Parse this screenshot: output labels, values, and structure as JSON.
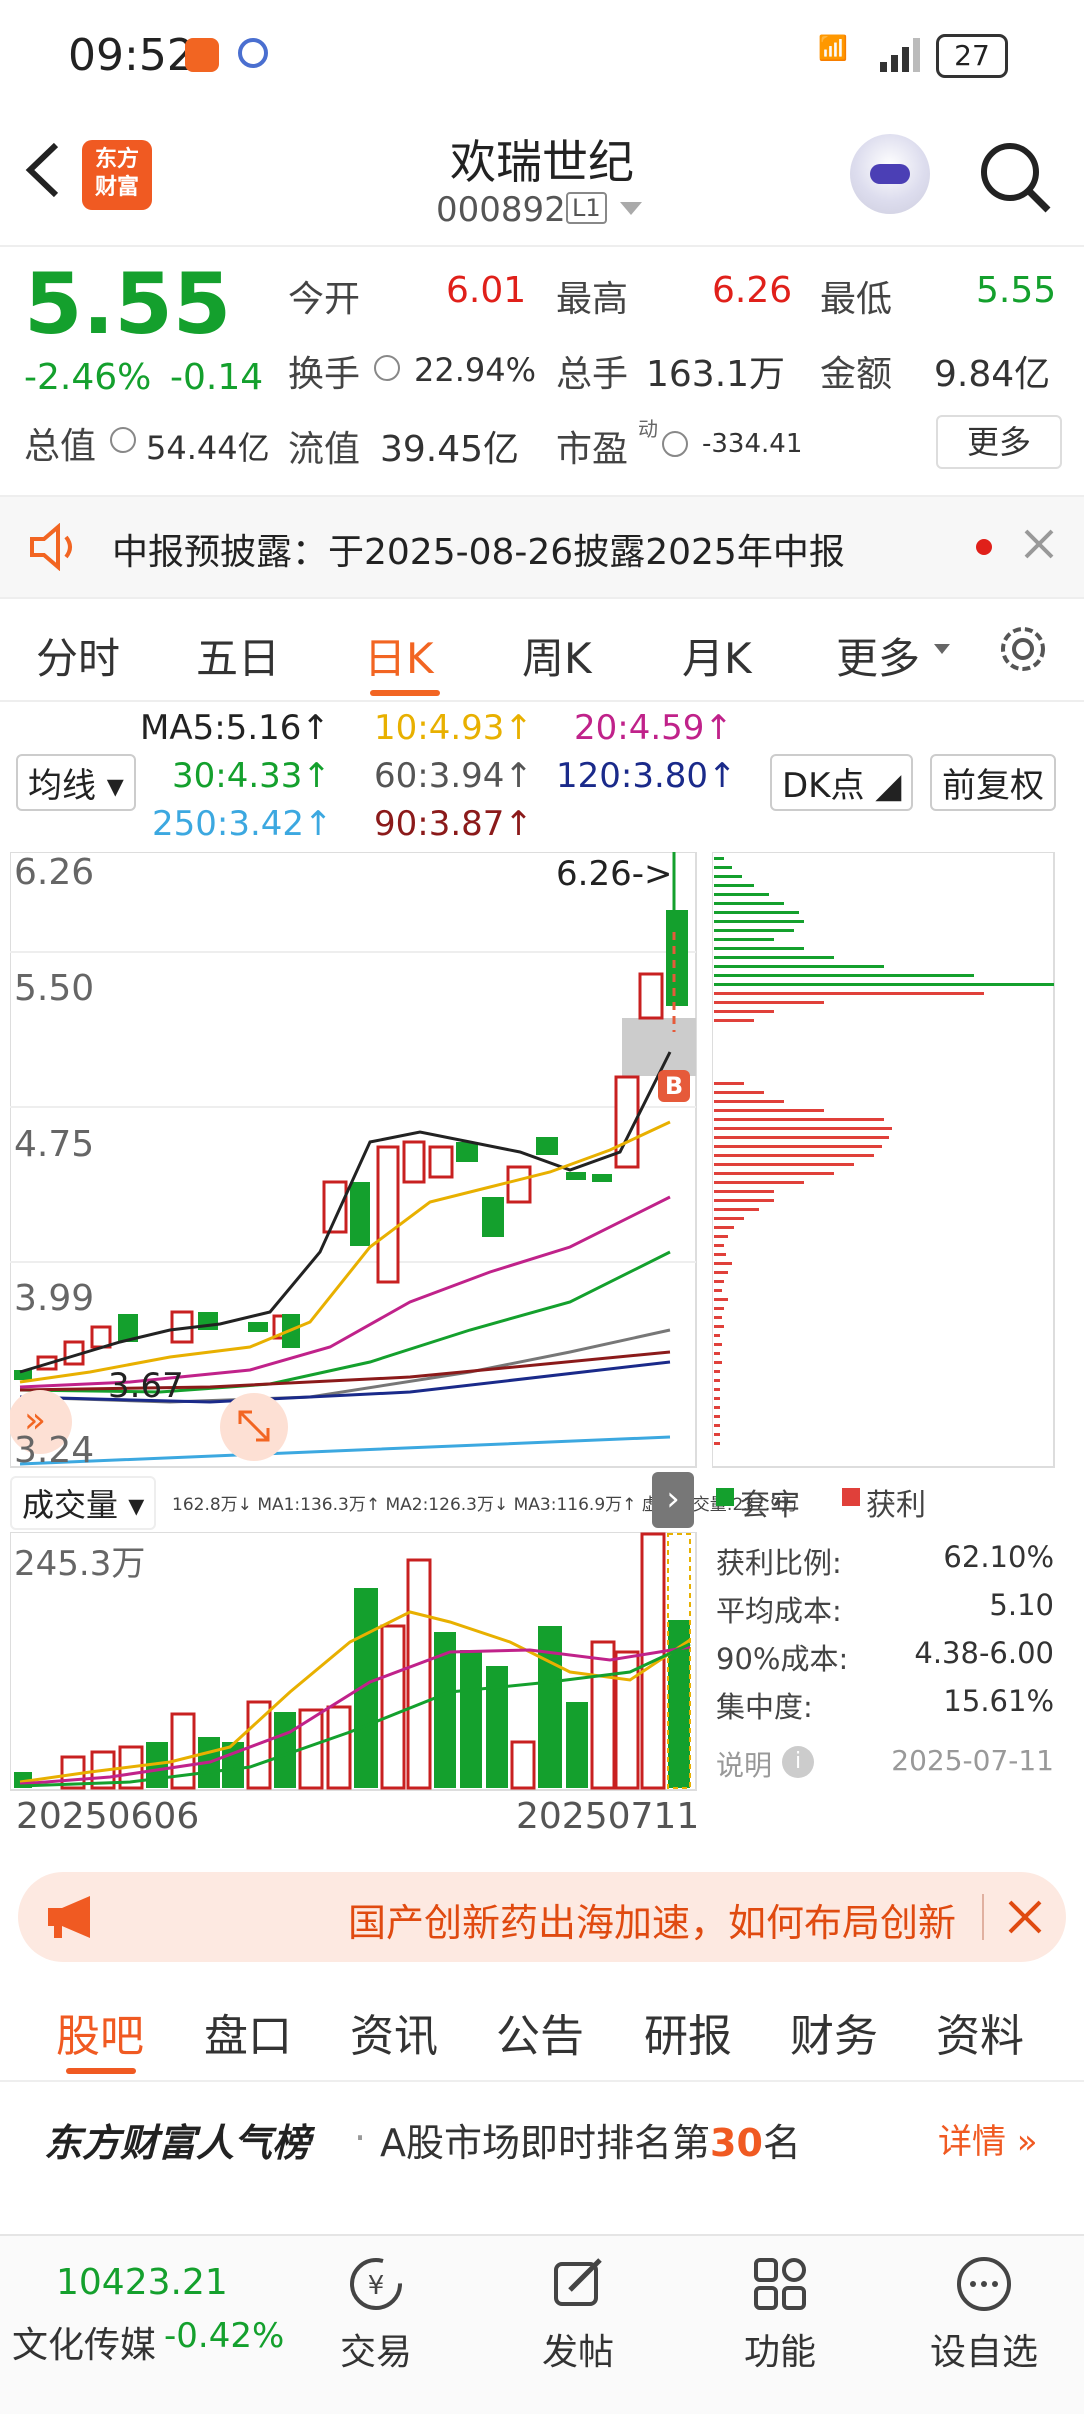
{
  "status_bar": {
    "time": "09:52",
    "battery": "27",
    "network": "5G"
  },
  "header": {
    "back_icon": "chevron-left-icon",
    "logo_text": "东方\n财富",
    "stock_name": "欢瑞世纪",
    "stock_code": "000892",
    "level_badge": "L1",
    "avatar_icon": "robot-avatar-icon",
    "search_icon": "search-icon"
  },
  "quote": {
    "price": "5.55",
    "change_pct": "-2.46%",
    "change_amt": "-0.14",
    "open_label": "今开",
    "open": "6.01",
    "high_label": "最高",
    "high": "6.26",
    "low_label": "最低",
    "low": "5.55",
    "turnover_label": "换手",
    "turnover": "22.94%",
    "volume_label": "总手",
    "volume": "163.1万",
    "amount_label": "金额",
    "amount": "9.84亿",
    "mktcap_label": "总值",
    "mktcap": "54.44亿",
    "float_label": "流值",
    "float": "39.45亿",
    "pe_label": "市盈",
    "pe_sup": "动",
    "pe": "-334.41",
    "more_button": "更多"
  },
  "notice": {
    "text": "中报预披露：于2025-08-26披露2025年中报"
  },
  "tabs": [
    {
      "label": "分时"
    },
    {
      "label": "五日"
    },
    {
      "label": "日K",
      "active": true
    },
    {
      "label": "周K"
    },
    {
      "label": "月K"
    },
    {
      "label": "更多"
    }
  ],
  "ma": {
    "ma5": "MA5:5.16↑",
    "ma10": "10:4.93↑",
    "ma20": "20:4.59↑",
    "ma30": "30:4.33↑",
    "ma60": "60:3.94↑",
    "ma120": "120:3.80↑",
    "ma250": "250:3.42↑",
    "ma90": "90:3.87↑",
    "ma_button": "均线",
    "dk_button": "DK点",
    "fq_button": "前复权"
  },
  "kchart": {
    "y_labels": [
      "6.26",
      "5.50",
      "4.75",
      "3.99",
      "3.24"
    ],
    "high_mark": "6.26->",
    "low_mark": "3.67",
    "b_marker": "B"
  },
  "volume": {
    "label": "成交量",
    "ma_info": "162.8万↓ MA1:136.3万↑ MA2:126.3万↓ MA3:116.9万↑ 虚拟成交量:237.9万",
    "max_label": "245.3万",
    "date_start": "20250606",
    "date_end": "20250711"
  },
  "chip": {
    "legend_trapped": "套牢",
    "legend_profit": "获利",
    "rows": [
      {
        "label": "获利比例:",
        "value": "62.10%"
      },
      {
        "label": "平均成本:",
        "value": "5.10"
      },
      {
        "label": "90%成本:",
        "value": "4.38-6.00"
      },
      {
        "label": "集中度:",
        "value": "15.61%"
      }
    ],
    "note_label": "说明",
    "date": "2025-07-11"
  },
  "banner": {
    "text": "国产创新药出海加速，如何布局创新"
  },
  "tabs2": [
    {
      "label": "股吧",
      "active": true
    },
    {
      "label": "盘口"
    },
    {
      "label": "资讯"
    },
    {
      "label": "公告"
    },
    {
      "label": "研报"
    },
    {
      "label": "财务"
    },
    {
      "label": "资料"
    }
  ],
  "popular": {
    "brand": "东方财富人气榜",
    "text_prefix": "A股市场即时排名第",
    "rank": "30",
    "text_suffix": "名",
    "detail": "详情"
  },
  "bottom": {
    "index_value": "10423.21",
    "index_name": "文化传媒",
    "index_change": "-0.42%",
    "items": [
      {
        "label": "交易",
        "icon": "trade-icon"
      },
      {
        "label": "发帖",
        "icon": "edit-icon"
      },
      {
        "label": "功能",
        "icon": "grid-icon"
      },
      {
        "label": "设自选",
        "icon": "more-icon"
      }
    ]
  }
}
